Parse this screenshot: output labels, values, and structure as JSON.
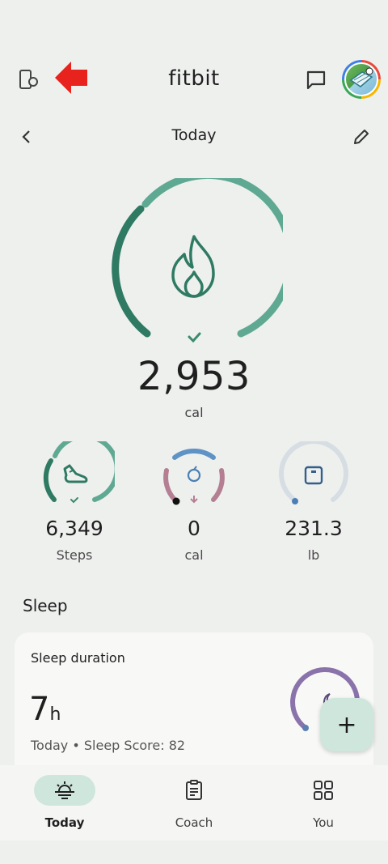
{
  "app": {
    "title": "fitbit"
  },
  "date_nav": {
    "label": "Today"
  },
  "calories": {
    "value": "2,953",
    "unit": "cal"
  },
  "stats": [
    {
      "value": "6,349",
      "label": "Steps"
    },
    {
      "value": "0",
      "label": "cal"
    },
    {
      "value": "231.3",
      "label": "lb"
    }
  ],
  "sleep": {
    "section_title": "Sleep",
    "card_title": "Sleep duration",
    "hours": "7",
    "hours_unit": "h",
    "subtitle": "Today • Sleep Score: 82"
  },
  "fab": {
    "label": "+"
  },
  "nav": [
    {
      "label": "Today"
    },
    {
      "label": "Coach"
    },
    {
      "label": "You"
    }
  ],
  "colors": {
    "accent": "#4c9a86",
    "accent_dark": "#2f7a63",
    "food_mauve": "#b47f92",
    "food_blue": "#5f93c6",
    "weight_ring": "#d6dde3",
    "sleep_purple": "#8a72ab",
    "nav_pill": "#cfe6dd",
    "arrow_red": "#e8221c"
  }
}
